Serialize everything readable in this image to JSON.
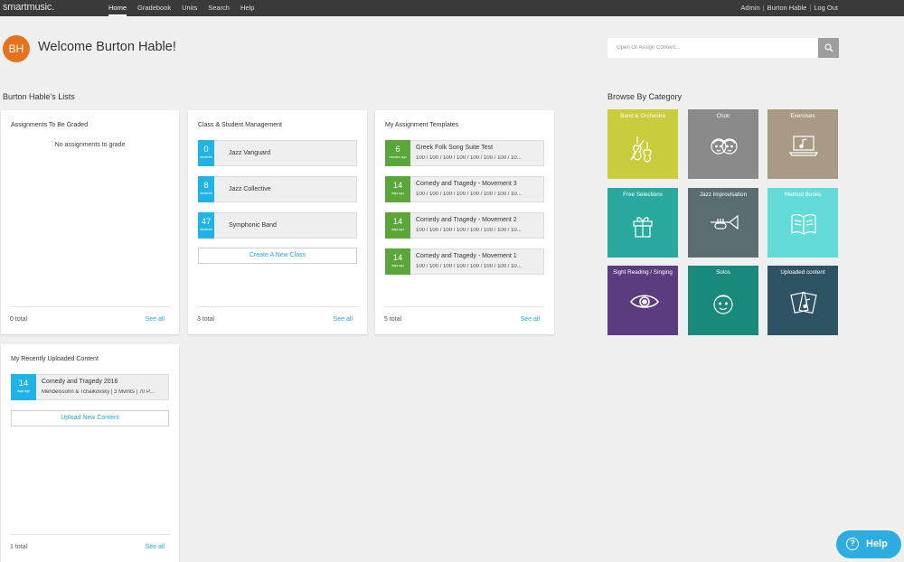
{
  "nav": {
    "logo": "smartmusic.",
    "links": [
      "Home",
      "Gradebook",
      "Units",
      "Search",
      "Help"
    ],
    "right": [
      "Admin",
      "Burton Hable",
      "Log Out"
    ],
    "separator": "|"
  },
  "user": {
    "initials": "BH",
    "welcome": "Welcome Burton Hable!",
    "avatar_color": "#e8721c"
  },
  "search": {
    "placeholder": "Open Or Assign Content..."
  },
  "lists_title": "Burton Hable's Lists",
  "cards": {
    "graded": {
      "title": "Assignments To Be Graded",
      "empty": "No assignments to grade",
      "total": "0 total",
      "see_all": "See all"
    },
    "classes": {
      "title": "Class & Student Management",
      "items": [
        {
          "count": "0",
          "unit": "students",
          "name": "Jazz Vanguard"
        },
        {
          "count": "8",
          "unit": "students",
          "name": "Jazz Collective"
        },
        {
          "count": "47",
          "unit": "students",
          "name": "Symphonic Band"
        }
      ],
      "create": "Create A New Class",
      "total": "3 total",
      "see_all": "See all"
    },
    "templates": {
      "title": "My Assignment Templates",
      "items": [
        {
          "count": "6",
          "unit": "minutes ago",
          "name": "Greek Folk Song Suite Test",
          "scores": "100 / 100 / 100 / 100 / 100 / 100 / 100 / 10..."
        },
        {
          "count": "14",
          "unit": "days ago",
          "name": "Comedy and Tragedy - Movement 3",
          "scores": "100 / 100 / 100 / 100 / 100 / 100 / 100 / 10..."
        },
        {
          "count": "14",
          "unit": "days ago",
          "name": "Comedy and Tragedy - Movement 2",
          "scores": "100 / 100 / 100 / 100 / 100 / 100 / 100 / 10..."
        },
        {
          "count": "14",
          "unit": "days ago",
          "name": "Comedy and Tragedy - Movement 1",
          "scores": "100 / 100 / 100 / 100 / 100 / 100 / 100 / 10..."
        }
      ],
      "total": "5 total",
      "see_all": "See all"
    },
    "uploaded": {
      "title": "My Recently Uploaded Content",
      "items": [
        {
          "count": "14",
          "unit": "days ago",
          "name": "Comedy and Tragedy 2016",
          "sub": "Mendelssohn & Tchaikovsky | 3 Mvmts | 70 P..."
        }
      ],
      "upload": "Upload New Content",
      "total": "1 total",
      "see_all": "See all"
    }
  },
  "browse": {
    "title": "Browse By Category",
    "tiles": [
      {
        "label": "Band & Orchestra",
        "color": "#c9cd3c",
        "icon": "violin-icon"
      },
      {
        "label": "Choir",
        "color": "#8a8a8a",
        "icon": "faces-icon"
      },
      {
        "label": "Exercises",
        "color": "#a89a85",
        "icon": "laptop-music-icon"
      },
      {
        "label": "Free Selections",
        "color": "#2aaa9e",
        "icon": "gift-icon"
      },
      {
        "label": "Jazz Improvisation",
        "color": "#5a6e6f",
        "icon": "trumpet-icon"
      },
      {
        "label": "Method Books",
        "color": "#63dcd9",
        "icon": "book-icon"
      },
      {
        "label": "Sight Reading / Singing",
        "color": "#5b3c7f",
        "icon": "eye-icon"
      },
      {
        "label": "Solos",
        "color": "#19897c",
        "icon": "face-icon"
      },
      {
        "label": "Uploaded content",
        "color": "#2e5463",
        "icon": "cards-icon"
      }
    ]
  },
  "help": {
    "label": "Help",
    "glyph": "?"
  }
}
